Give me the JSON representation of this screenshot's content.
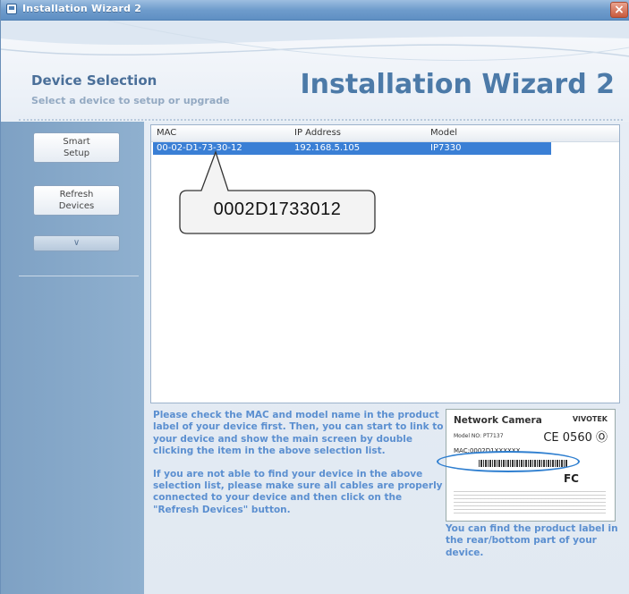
{
  "window": {
    "title": "Installation Wizard 2",
    "close_glyph": "×"
  },
  "header": {
    "title": "Device Selection",
    "subtitle": "Select a device to setup or upgrade",
    "brand": "Installation Wizard 2"
  },
  "sidebar": {
    "smart_setup": [
      "Smart",
      "Setup"
    ],
    "refresh_devices": [
      "Refresh",
      "Devices"
    ],
    "more_glyph": "∨"
  },
  "device_list": {
    "columns": [
      "MAC",
      "IP Address",
      "Model"
    ],
    "rows": [
      {
        "mac": "00-02-D1-73-30-12",
        "ip": "192.168.5.105",
        "model": "IP7330",
        "selected": true
      }
    ]
  },
  "callout": {
    "text": "0002D1733012"
  },
  "instructions": {
    "para1": "Please check the MAC and model name in the product label of your device first. Then, you can start to link to your device and show the main screen by double clicking the item in the above selection list.",
    "para2": "If you are not able to find your device in the above selection list, please make sure all cables are properly connected to your device and then click on the \"Refresh Devices\" button."
  },
  "product_label": {
    "title": "Network Camera",
    "brand": "VIVOTEK",
    "model": "Model NO: PT7137",
    "ce": "CE 0560 Ⓞ",
    "mac": "MAC:0002D1XXXXXX",
    "fc": "FC",
    "caption": "You can find the product label in the rear/bottom part of your device."
  },
  "colors": {
    "title_bar": "#6f9ccc",
    "sidebar": "#8aabcb",
    "selection": "#3a7fd5",
    "instruction_text": "#5b8fd0",
    "brand": "#4c7aa8"
  }
}
